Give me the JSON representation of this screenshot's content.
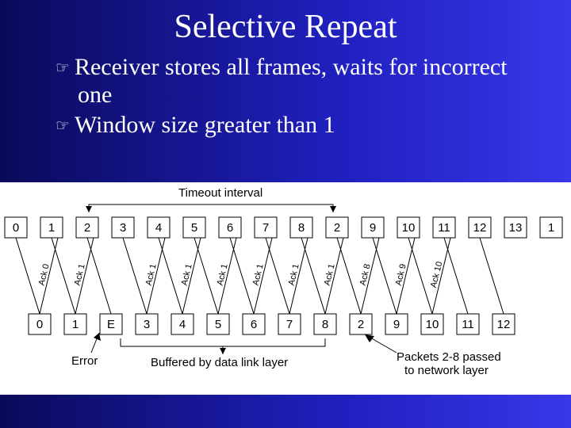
{
  "title": "Selective Repeat",
  "bullets": [
    "Receiver stores all frames, waits for incorrect one",
    "Window size greater than 1"
  ],
  "diagram": {
    "timeout_label": "Timeout interval",
    "top_seq": [
      "0",
      "1",
      "2",
      "3",
      "4",
      "5",
      "6",
      "7",
      "8",
      "2",
      "9",
      "10",
      "11",
      "12",
      "13",
      "1"
    ],
    "bottom_seq": [
      "0",
      "1",
      "E",
      "3",
      "4",
      "5",
      "6",
      "7",
      "8",
      "2",
      "9",
      "10",
      "11",
      "12"
    ],
    "ack_labels": [
      "Ack 0",
      "Ack 1",
      "Ack 1",
      "Ack 1",
      "Ack 1",
      "Ack 1",
      "Ack 1",
      "Ack 1",
      "Ack 8",
      "Ack 9",
      "Ack 10"
    ],
    "error_label": "Error",
    "buffered_label": "Buffered by data link layer",
    "passed_label_l1": "Packets 2-8 passed",
    "passed_label_l2": "to network layer"
  },
  "chart_data": {
    "type": "table",
    "title": "Selective Repeat ARQ timing diagram",
    "sender_sequence": [
      0,
      1,
      2,
      3,
      4,
      5,
      6,
      7,
      8,
      2,
      9,
      10,
      11,
      12,
      13
    ],
    "receiver_sequence": [
      0,
      1,
      "E",
      3,
      4,
      5,
      6,
      7,
      8,
      2,
      9,
      10,
      11,
      12
    ],
    "acks": [
      "Ack 0",
      "Ack 1",
      "Ack 1",
      "Ack 1",
      "Ack 1",
      "Ack 1",
      "Ack 1",
      "Ack 1",
      "Ack 8",
      "Ack 9",
      "Ack 10"
    ],
    "annotations": {
      "error_at_receiver_index": 2,
      "buffered_receiver_indices": [
        3,
        4,
        5,
        6,
        7,
        8
      ],
      "passed_to_network_after_retransmit": [
        2,
        3,
        4,
        5,
        6,
        7,
        8
      ],
      "timeout_interval_sender_span": [
        2,
        9
      ]
    }
  }
}
